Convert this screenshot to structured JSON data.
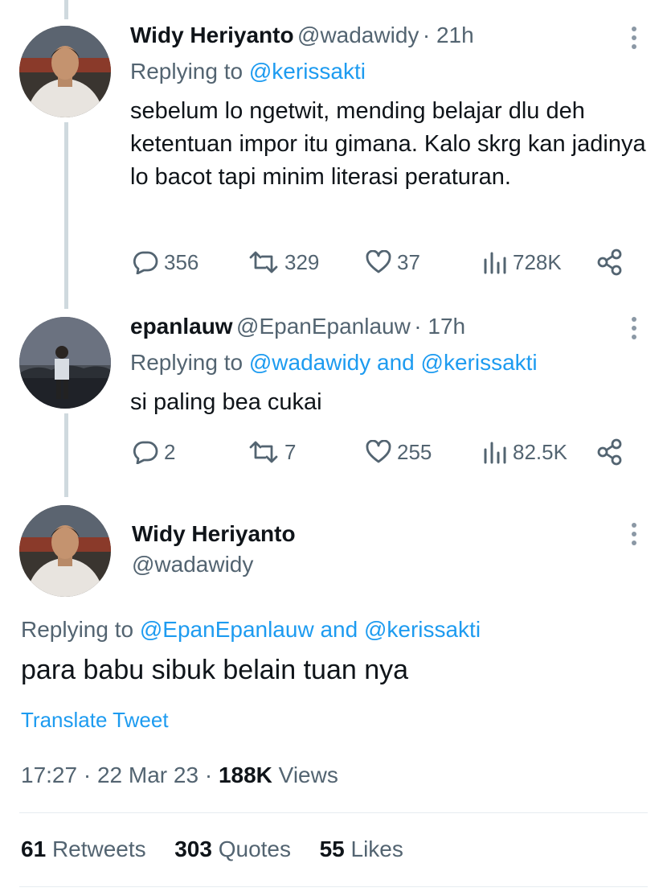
{
  "tweets": [
    {
      "name": "Widy Heriyanto",
      "handle": "@wadawidy",
      "time": "· 21h",
      "reply_prefix": "Replying to",
      "reply_targets": "@kerissakti",
      "body": "sebelum lo ngetwit, mending belajar dlu deh ketentuan impor itu gimana. Kalo skrg kan jadinya lo bacot tapi minim literasi peraturan.",
      "replies": "356",
      "retweets": "329",
      "likes": "37",
      "views": "728K"
    },
    {
      "name": "epanlauw",
      "handle": "@EpanEpanlauw",
      "time": "· 17h",
      "reply_prefix": "Replying to",
      "reply_targets": "@wadawidy and @kerissakti",
      "body": "si paling bea cukai",
      "replies": "2",
      "retweets": "7",
      "likes": "255",
      "views": "82.5K"
    }
  ],
  "main": {
    "name": "Widy Heriyanto",
    "handle": "@wadawidy",
    "reply_prefix": "Replying to",
    "reply_targets": "@EpanEpanlauw and @kerissakti",
    "body": "para babu sibuk belain tuan nya",
    "translate": "Translate Tweet",
    "time": "17:27",
    "date": "22 Mar 23",
    "views_count": "188K",
    "views_label": "Views",
    "retweets_count": "61",
    "retweets_label": "Retweets",
    "quotes_count": "303",
    "quotes_label": "Quotes",
    "likes_count": "55",
    "likes_label": "Likes"
  },
  "icons": {
    "reply": "speech-bubble-icon",
    "retweet": "retweet-arrows-icon",
    "like": "heart-icon",
    "views": "bar-chart-icon",
    "share": "share-icon",
    "more": "more-vertical-icon"
  },
  "colors": {
    "link": "#1d9bf0",
    "secondary": "#536471",
    "text": "#0f1419"
  }
}
